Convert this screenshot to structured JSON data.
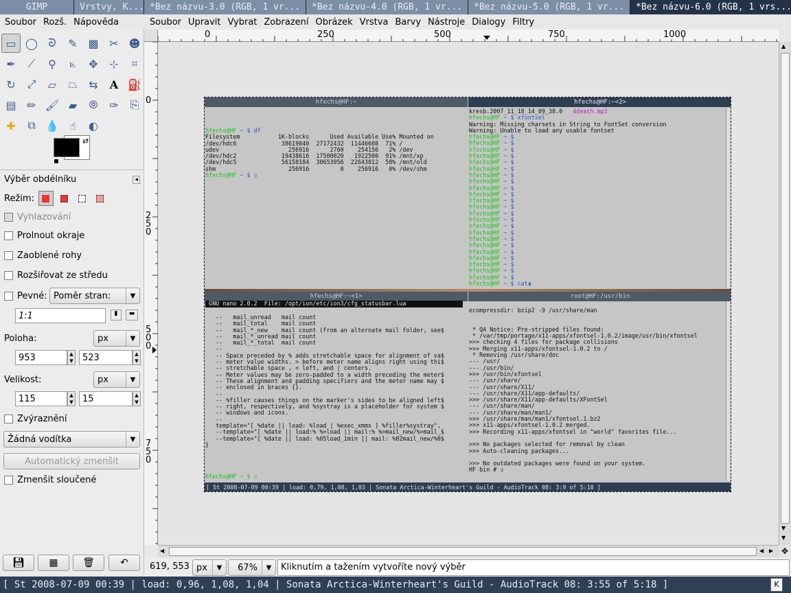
{
  "tabs": [
    "GIMP",
    "Vrstvy, K...",
    "*Bez názvu-3.0 (RGB, 1 vr...",
    "*Bez názvu-4.0 (RGB, 1 vr...",
    "*Bez názvu-5.0 (RGB, 1 vr...",
    "*Bez názvu-6.0 (RGB, 1 vrs..."
  ],
  "toolbox_menu": [
    "Soubor",
    "Rozš.",
    "Nápověda"
  ],
  "image_menu": [
    "Soubor",
    "Upravit",
    "Vybrat",
    "Zobrazení",
    "Obrázek",
    "Vrstva",
    "Barvy",
    "Nástroje",
    "Dialogy",
    "Filtry"
  ],
  "tools": [
    "rect-select-icon",
    "ellipse-select-icon",
    "lasso-icon",
    "fuzzy-select-icon",
    "color-select-icon",
    "scissors-icon",
    "foreground-select-icon",
    "paths-icon",
    "color-picker-icon",
    "zoom-icon",
    "measure-icon",
    "move-icon",
    "align-icon",
    "crop-icon",
    "rotate-icon",
    "scale-icon",
    "shear-icon",
    "perspective-icon",
    "flip-icon",
    "text-icon",
    "bucket-fill-icon",
    "blend-icon",
    "pencil-icon",
    "paintbrush-icon",
    "eraser-icon",
    "airbrush-icon",
    "ink-icon",
    "clone-icon",
    "heal-icon",
    "perspective-clone-icon",
    "blur-icon",
    "smudge-icon",
    "dodge-burn-icon"
  ],
  "options": {
    "title": "Výběr obdélníku",
    "mode_label": "Režim:",
    "antialias": "Vyhlazování",
    "feather": "Prolnout okraje",
    "rounded": "Zaoblené rohy",
    "expand": "Rozšiřovat ze středu",
    "fixed": "Pevné:",
    "fixed_mode": "Poměr stran:",
    "ratio": "1:1",
    "position_label": "Poloha:",
    "unit": "px",
    "pos_x": "953",
    "pos_y": "523",
    "size_label": "Velikost:",
    "size_w": "115",
    "size_h": "15",
    "highlight": "Zvýraznění",
    "guides": "Žádná vodítka",
    "autoshrink": "Automatický zmenšit",
    "shrink_merged": "Zmenšit sloučené"
  },
  "ruler_h": [
    "0",
    "250",
    "500",
    "750",
    "1000"
  ],
  "ruler_v": [
    "0",
    "250",
    "500",
    "750"
  ],
  "status": {
    "coords": "619, 553",
    "unit": "px",
    "zoom": "67%",
    "message": "Kliknutím a tažením vytvoříte nový výběr"
  },
  "taskbar_text": "[ St 2008-07-09 00:39 | load: 0,96, 1,08, 1,04 | Sonata Arctica-Winterheart's Guild - AudioTrack 08: 3:55 of 5:18 ]",
  "screenshot": {
    "t1_title": "hfechs@HF:~",
    "t2_title": "hfechs@HF:~<2>",
    "t3_title": "hfechs@HF:~<1>",
    "t4_title": "root@HF:/usr/bin",
    "t1_text": "hfechs@HF ~ $ df\nFilesystem           1K-blocks      Used Available Use% Mounted on\n/dev/hdc6             38619040  27172432  11446608  71% /\nudev                    256916      2760    254156   2% /dev\n/dev/hdc2             19438616  17500020   1922500  91% /mnt/xp\n/dev/hdc5             56158184  30653956  22643812  58% /mnt/old\nshm                     256916         0    256916   0% /dev/shm\nhfechs@HF ~ $ ▯",
    "t2_text": "kresb.2007_11_18_14_09_38.0   4death.mp3\nhfechs@HF ~ $ xfontsel\nWarning: Missing charsets in String to FontSet conversion\nWarning: Unable to load any usable fontset",
    "t2_prompt": "hfechs@HF ~ $",
    "t2_last": "hfechs@HF ~ $ cat▮",
    "t3_header": " GNU nano 2.0.2  File: /opt/ion/etc/ion3/cfg_statusbar.lua",
    "t3_text": "   --   mail_unread   mail count\n   --   mail_total    mail count\n   --   mail_*_new    mail count (from an alternate mail folder, see$\n   --   mail_*_unread mail count\n   --   mail_*_total  mail count\n   --\n   -- Space preceded by % adds stretchable space for alignment of va$\n   -- meter value widths. > before meter name aligns right using thi$\n   -- stretchable space , < left, and | centers.\n   -- Meter values may be zero-padded to a width preceding the meter$\n   -- These alignment and padding specifiers and the meter name may $\n   -- enclosed in braces {}.\n   --\n   -- %filler causes things on the marker's sides to be aligned left$\n   -- right, respectively, and %systray is a placeholder for system $\n   -- windows and icons.\n   --\n   template=\"[ %date || load: %load | %exec_xmms ] %filler%systray\",\n   --template=\"[ %date || load:% %>load || mail:% %>mail_new/%>mail_$\n   --template=\"[ %date || load: %05load_1min || mail: %02mail_new/%0$\n}",
    "t3_prompt": "hfechs@HF ~ $ ▯",
    "t4_text": "ecompressdir: bzip2 -9 /usr/share/man\n\n\n * QA Notice: Pre-stripped files found:\n * /var/tmp/portage/x11-apps/xfontsel-1.0.2/image/usr/bin/xfontsel\n>>> checking 4 files for package collisions\n>>> Merging x11-apps/xfontsel-1.0.2 to /\n * Removing /usr/share/doc\n--- /usr/\n--- /usr/bin/\n>>> /usr/bin/xfontsel\n--- /usr/share/\n--- /usr/share/X11/\n--- /usr/share/X11/app-defaults/\n>>> /usr/share/X11/app-defaults/XFontSel\n--- /usr/share/man/\n--- /usr/share/man/man1/\n>>> /usr/share/man/man1/xfontsel.1.bz2\n>>> x11-apps/xfontsel-1.0.2 merged.\n>>> Recording x11-apps/xfontsel in \"world\" favorites file...\n\n>>> No packages selected for removal by clean\n>>> Auto-cleaning packages...\n\n>>> No outdated packages were found on your system.\nHF bin # ▯",
    "inner_status": "[ St 2008-07-09 00:39 | load: 0,79, 1,08, 1,03 | Sonata Arctica-Winterheart's Guild - AudioTrack 08: 3:9 of 5:18 ]"
  },
  "colors": {
    "accent": "#2d3e52",
    "prompt": "#19c419",
    "path": "#2b4fd0"
  }
}
